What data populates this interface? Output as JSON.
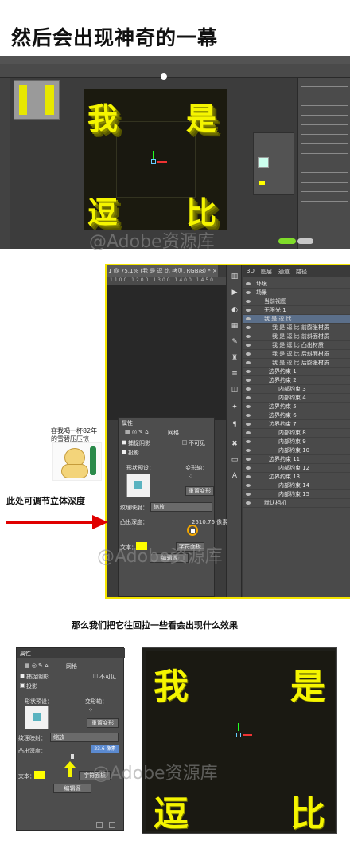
{
  "heading": "然后会出现神奇的一幕",
  "panel1": {
    "canvas_chars": [
      "我",
      "是",
      "逗",
      "比"
    ],
    "watermark": "@Adobe资源库"
  },
  "panel2": {
    "doc_tab": "1 @ 75.1% (我 是 逗 比 拷贝, RGB/8) *  ×",
    "ruler": "1100 1200 1300 1400 1450",
    "layers_tabs": [
      "3D",
      "图层",
      "通道",
      "路径"
    ],
    "layers": [
      "环境",
      "场景",
      "当前视图",
      "无限光 1",
      "我 是 逗 比",
      "我 是 逗 比 前膨胀材质",
      "我 是 逗 比 前斜面材质",
      "我 是 逗 比 凸出材质",
      "我 是 逗 比 后斜面材质",
      "我 是 逗 比 后膨胀材质",
      "边界约束 1",
      "边界约束 2",
      "内部约束 3",
      "内部约束 4",
      "边界约束 5",
      "边界约束 6",
      "边界约束 7",
      "内部约束 8",
      "内部约束 9",
      "内部约束 10",
      "边界约束 11",
      "内部约束 12",
      "边界约束 13",
      "内部约束 14",
      "内部约束 15",
      "默认相机"
    ],
    "properties": {
      "title": "属性",
      "tab_mesh": "网格",
      "catch_shadow": "捕捉阴影",
      "invisible": "不可见",
      "cast_shadow": "投影",
      "shape_preset": "形状预设：",
      "deform_axis": "变形轴：",
      "reset_deform": "重置变形",
      "texture_map": "纹理映射：",
      "texture_value": "缩放",
      "extrude_depth": "凸出深度：",
      "extrude_value": "2510.76 像素",
      "text_label": "文本：",
      "char_panel": "字符面板",
      "edit_source": "编辑源",
      "text_color": "#ffff00"
    },
    "meme_caption_1": "容我喝一杯82年",
    "meme_caption_2": "的雪碧压压惊",
    "watermark": "@Adobe资源库"
  },
  "side_label": "此处可调节立体深度",
  "caption2": "那么我们把它往回拉一些看会出现什么效果",
  "panel3": {
    "properties": {
      "title": "属性",
      "tab_mesh": "网格",
      "catch_shadow": "捕捉阴影",
      "invisible": "不可见",
      "cast_shadow": "投影",
      "shape_preset": "形状预设：",
      "deform_axis": "变形轴：",
      "reset_deform": "重置变形",
      "texture_map": "纹理映射：",
      "texture_value": "缩放",
      "extrude_depth": "凸出深度：",
      "extrude_value": "23.6 像素",
      "text_label": "文本：",
      "char_panel": "字符面板",
      "edit_source": "编辑源",
      "text_color": "#ffff00"
    },
    "canvas_chars": [
      "我",
      "是",
      "逗",
      "比"
    ],
    "watermark": "@Adobe资源库"
  },
  "colors": {
    "accent": "#f4e500",
    "text_yellow": "#f5f500",
    "arrow_red": "#e00000"
  }
}
